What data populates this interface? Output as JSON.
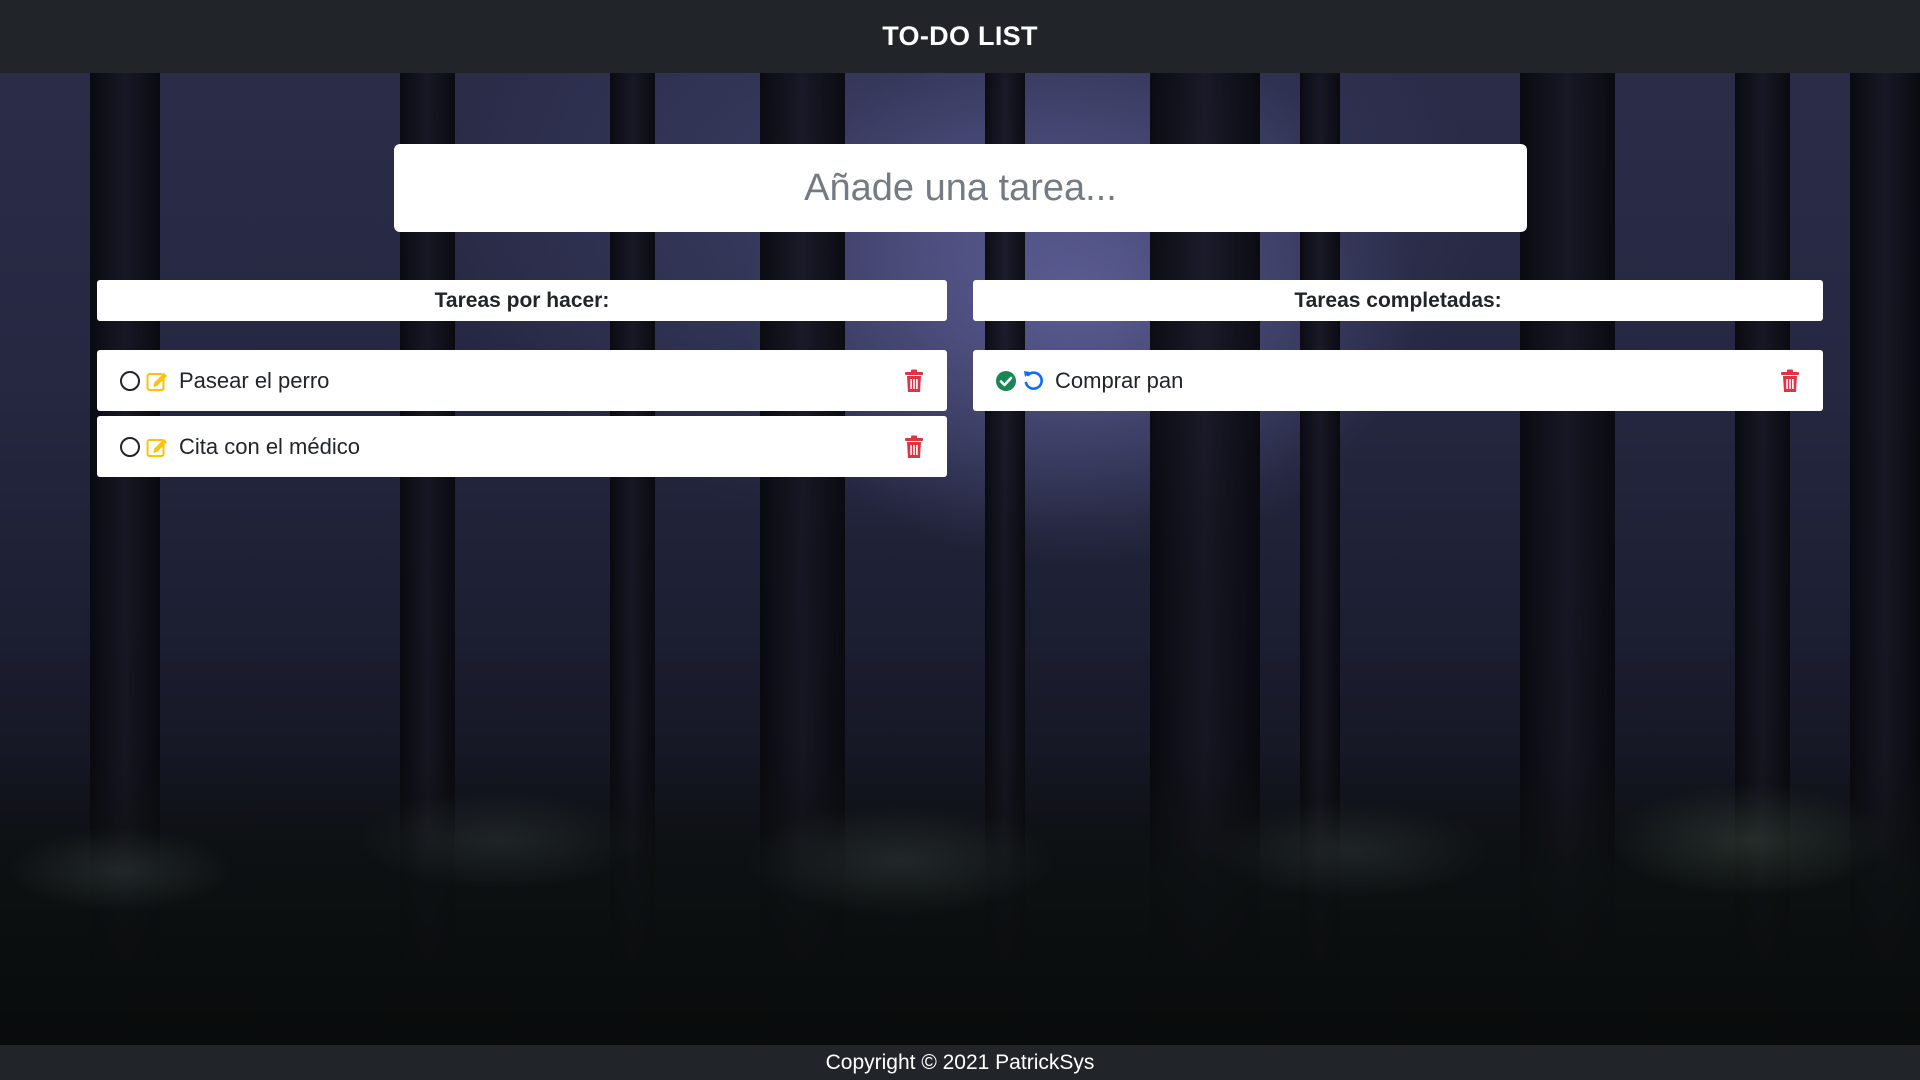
{
  "navbar": {
    "title": "TO-DO LIST"
  },
  "new_task": {
    "placeholder": "Añade una tarea...",
    "value": ""
  },
  "pending": {
    "header": "Tareas por hacer:",
    "tasks": [
      {
        "label": "Pasear el perro"
      },
      {
        "label": "Cita con el médico"
      }
    ]
  },
  "completed": {
    "header": "Tareas completadas:",
    "tasks": [
      {
        "label": "Comprar pan"
      }
    ]
  },
  "footer": {
    "text": "Copyright © 2021 PatrickSys"
  },
  "colors": {
    "navbar": "#212529",
    "edit_icon": "#ffc107",
    "delete_icon": "#dc3545",
    "check_icon": "#198754",
    "undo_icon": "#0d6efd"
  },
  "icons": {
    "pending_task": [
      "circle-icon",
      "edit-icon",
      "trash-icon"
    ],
    "completed_task": [
      "check-circle-icon",
      "undo-icon",
      "trash-icon"
    ]
  }
}
